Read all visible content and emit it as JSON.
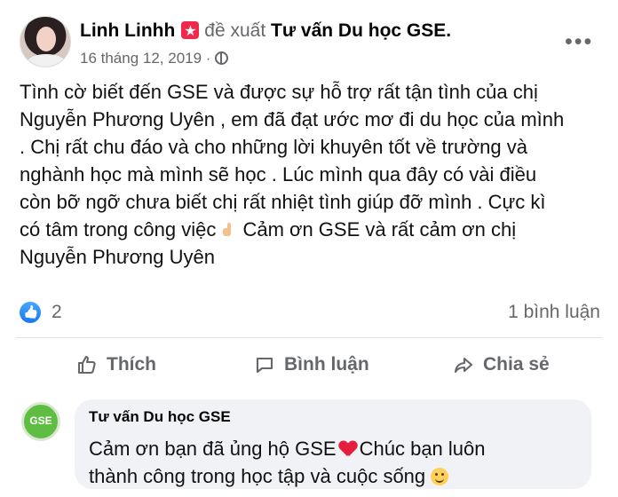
{
  "post": {
    "author": "Linh Linhh",
    "recommendation_text": "đề xuất",
    "page_name": "Tư vấn Du học GSE.",
    "date": "16 tháng 12, 2019 ·",
    "icons": {
      "author_badge": "star-badge-icon",
      "privacy": "globe-icon",
      "more": "more-options-icon"
    },
    "body": [
      "Tình cờ biết đến GSE và được sự hỗ trợ rất tận tình của chị",
      "Nguyễn Phương Uyên , em đã đạt ước mơ đi du học của mình",
      ". Chị rất chu đáo và cho những lời khuyên tốt về trường và",
      "nghành học mà mình sẽ học . Lúc mình qua đây có vài điều",
      "còn bỡ ngỡ chưa biết chị rất nhiệt tình giúp đỡ mình . Cực kì",
      "có tâm trong công việc",
      "Cảm ơn GSE và rất cảm ơn chị",
      "Nguyễn Phương Uyên"
    ]
  },
  "reactions": {
    "like_count": "2",
    "comment_count": "1 bình luận",
    "icon": "like-reaction-icon"
  },
  "actions": {
    "like": "Thích",
    "comment": "Bình luận",
    "share": "Chia sẻ"
  },
  "comment": {
    "avatar_text": "GSE",
    "author": "Tư vấn Du học GSE",
    "line1_before_heart": "Cảm ơn bạn đã ủng hộ GSE",
    "line1_after_heart": "Chúc bạn luôn",
    "line2": "thành công trong học tập và cuộc sống"
  },
  "colors": {
    "text": "#050505",
    "muted": "#65676b",
    "facebook_blue": "#1877f2",
    "comment_background": "#f0f2f5",
    "heart": "#e41e3f"
  }
}
